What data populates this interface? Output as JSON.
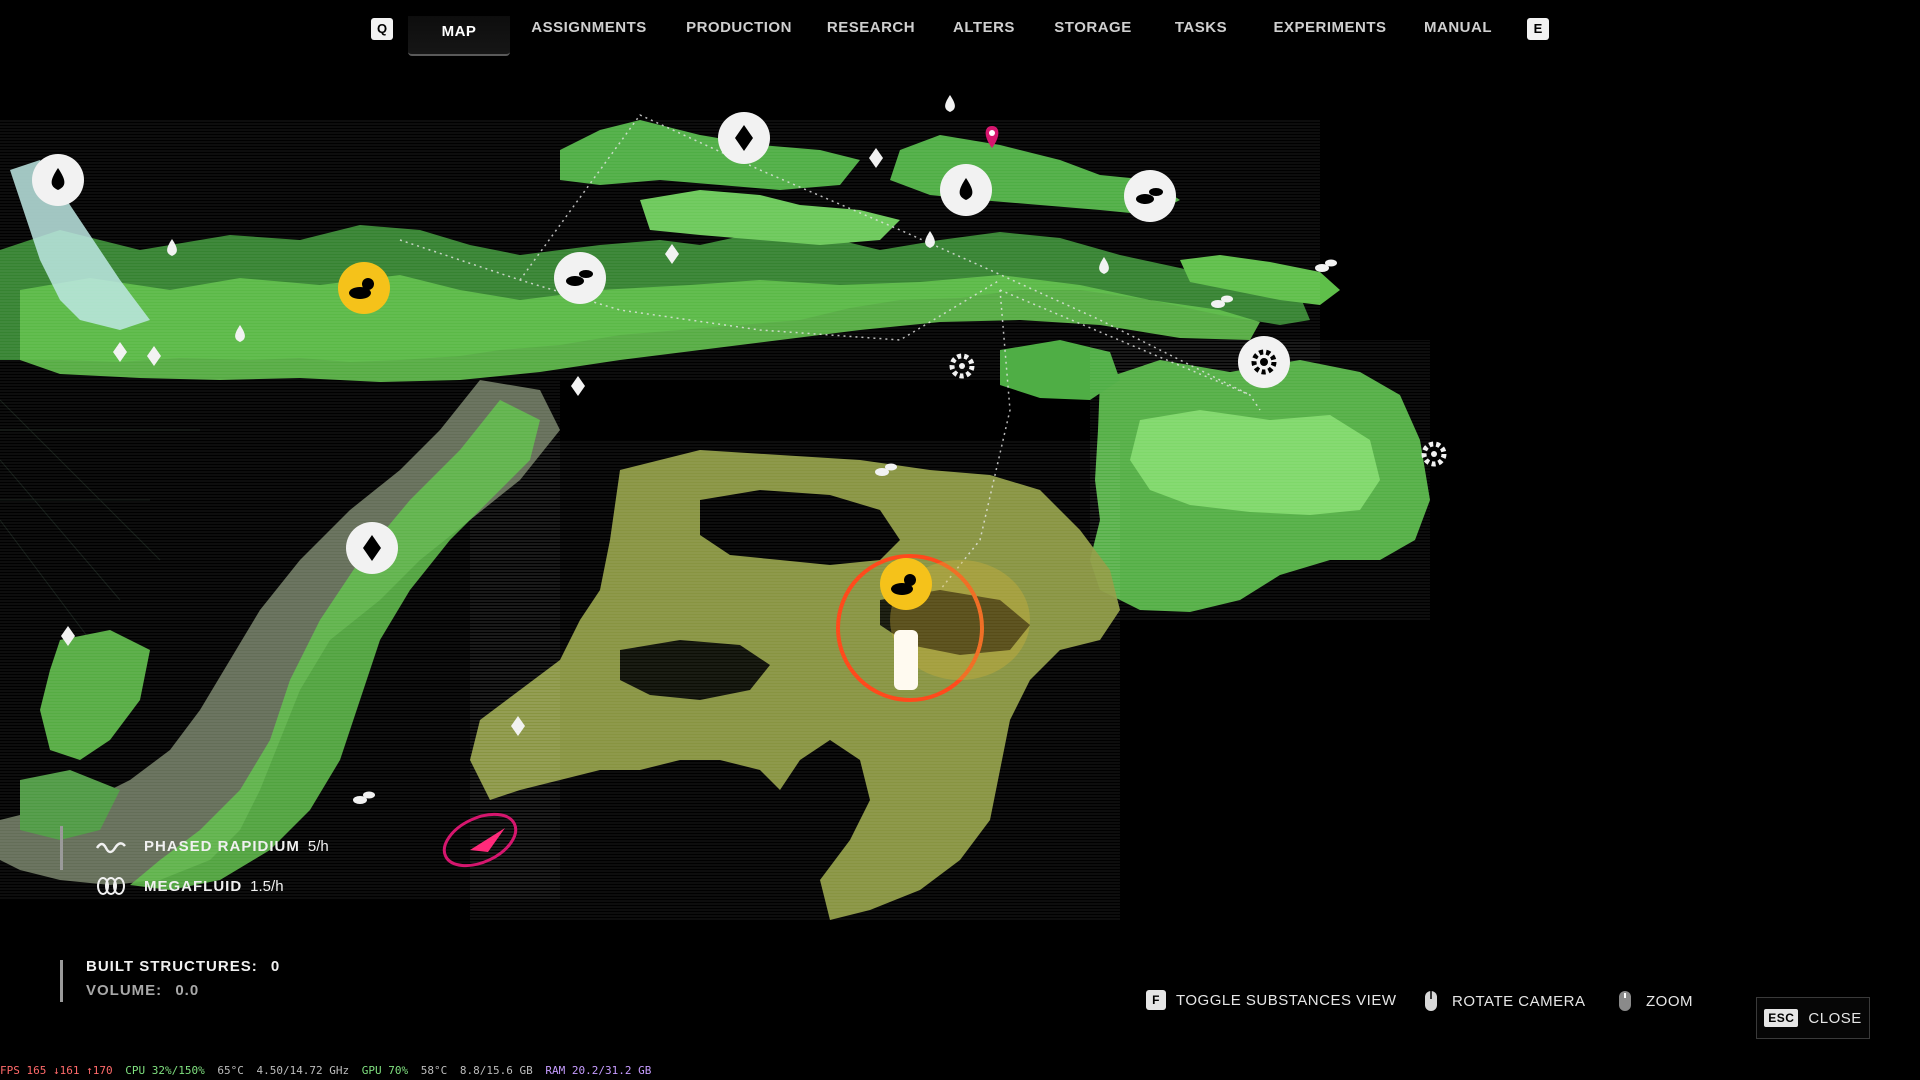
{
  "nav": {
    "prev_key": "Q",
    "next_key": "E",
    "tabs": [
      {
        "label": "MAP",
        "active": true
      },
      {
        "label": "ASSIGNMENTS",
        "active": false
      },
      {
        "label": "PRODUCTION",
        "active": false
      },
      {
        "label": "RESEARCH",
        "active": false
      },
      {
        "label": "ALTERS",
        "active": false
      },
      {
        "label": "STORAGE",
        "active": false
      },
      {
        "label": "TASKS",
        "active": false
      },
      {
        "label": "EXPERIMENTS",
        "active": false
      },
      {
        "label": "MANUAL",
        "active": false
      }
    ]
  },
  "resources": [
    {
      "name": "PHASED RAPIDIUM",
      "rate": "5/h",
      "icon": "wave-icon"
    },
    {
      "name": "MEGAFLUID",
      "rate": "1.5/h",
      "icon": "triple-loop-icon"
    }
  ],
  "structures": {
    "built_label": "BUILT STRUCTURES:",
    "built_value": "0",
    "volume_label": "VOLUME:",
    "volume_value": "0.0"
  },
  "controls": {
    "toggle_key": "F",
    "toggle_label": "TOGGLE SUBSTANCES VIEW",
    "rotate_label": "ROTATE CAMERA",
    "zoom_label": "ZOOM",
    "close_key": "ESC",
    "close_label": "CLOSE"
  },
  "perf": {
    "fps": "FPS 165 ↓161 ↑170",
    "cpu": "CPU 32%/150%",
    "cpu_temp": "65°C",
    "cpu_clock": "4.50/14.72 GHz",
    "gpu": "GPU 70%",
    "gpu_temp": "58°C",
    "gpu_mem": "8.8/15.6 GB",
    "ram": "RAM 20.2/31.2 GB"
  },
  "colors": {
    "terrain_green": "#5fbf4a",
    "terrain_light": "#8ee07a",
    "terrain_olive": "#9aa64a",
    "highlight_orange": "#ff4a1c",
    "marker_yellow": "#f5c21a",
    "marker_magenta": "#d6166e",
    "background": "#000000"
  },
  "markers": [
    {
      "icon": "water-drop-icon"
    },
    {
      "icon": "water-drop-icon"
    },
    {
      "icon": "water-drop-icon"
    },
    {
      "icon": "diamond-icon"
    },
    {
      "icon": "diamond-icon"
    },
    {
      "icon": "resource-pills-icon"
    },
    {
      "icon": "resource-pills-icon"
    },
    {
      "icon": "gear-icon"
    },
    {
      "icon": "gear-icon"
    },
    {
      "icon": "gear-icon"
    },
    {
      "icon": "sun-cloud-icon"
    },
    {
      "icon": "sun-cloud-icon"
    },
    {
      "icon": "location-pin-icon"
    }
  ]
}
